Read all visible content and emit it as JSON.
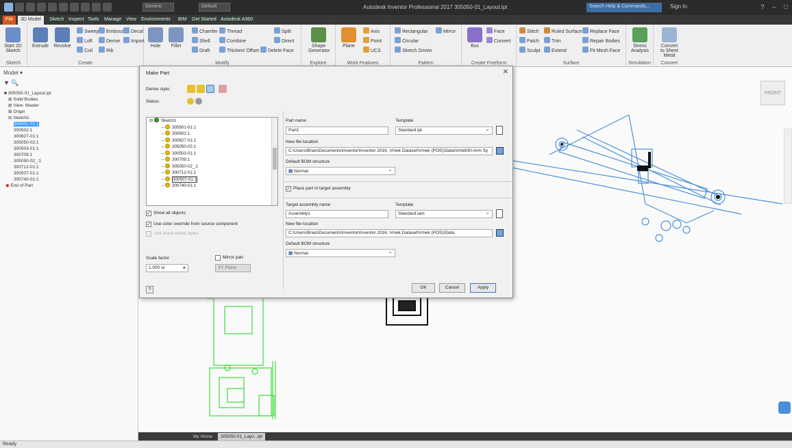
{
  "title_bar": {
    "app_title": "Autodesk Inventor Professional 2017  305050-01_Layout.ipt",
    "combo1": "Generic",
    "combo2": "Default",
    "search_placeholder": "Search Help & Commands...",
    "sign_in": "Sign In"
  },
  "ribbon_tabs": [
    "File",
    "3D Model",
    "Sketch",
    "Inspect",
    "Tools",
    "Manage",
    "View",
    "Environments",
    "BIM",
    "Get Started",
    "Autodesk A360"
  ],
  "ribbon": {
    "sketch_group": {
      "label": "Sketch",
      "start_2d_sketch": "Start 2D Sketch"
    },
    "create_group": {
      "label": "Create",
      "buttons": [
        "Extrude",
        "Revolve",
        "Sweep",
        "Loft",
        "Coil",
        "Emboss",
        "Derive",
        "Rib",
        "Decal",
        "Import"
      ]
    },
    "modify_group": {
      "label": "Modify",
      "buttons": [
        "Hole",
        "Fillet",
        "Chamfer",
        "Shell",
        "Draft",
        "Thread",
        "Combine",
        "Thicken/ Offset",
        "Split",
        "Direct",
        "Delete Face"
      ]
    },
    "explore_group": {
      "label": "Explore",
      "buttons": [
        "Shape Generator"
      ]
    },
    "work_group": {
      "label": "Work Features",
      "buttons": [
        "Plane",
        "Axis",
        "Point",
        "UCS"
      ]
    },
    "pattern_group": {
      "label": "Pattern",
      "buttons": [
        "Rectangular",
        "Circular",
        "Sketch Driven",
        "Mirror"
      ]
    },
    "freeform_group": {
      "label": "Create Freeform",
      "buttons": [
        "Box",
        "Face",
        "Convert"
      ]
    },
    "surface_group": {
      "label": "Surface",
      "buttons": [
        "Stitch",
        "Patch",
        "Sculpt",
        "Trim",
        "Extend",
        "Ruled Surface",
        "Repair Bodies",
        "Fit Mesh Face",
        "Replace Face"
      ]
    },
    "simulation_group": {
      "label": "Simulation",
      "buttons": [
        "Stress Analysis"
      ]
    },
    "convert_group": {
      "label": "Convert",
      "buttons": [
        "Convert to Sheet Metal"
      ]
    }
  },
  "browser": {
    "title": "Model",
    "items": [
      "305050-01_Layout.ipt",
      "Solid Bodies",
      "View: Master",
      "Origin",
      "Sketch1",
      "305501-01:1",
      "300502:1",
      "300627-01:1",
      "305050-02:1",
      "300503-01:1",
      "300709:1",
      "305050-02_:1",
      "300712-01:1",
      "300507-01:1",
      "300740-01:1",
      "End of Part"
    ]
  },
  "make_part_dialog": {
    "title": "Make Part",
    "derive_style_label": "Derive style:",
    "status_label": "Status:",
    "tree_root": "Sketch1",
    "tree_items": [
      "305501-01:1",
      "300502:1",
      "300627-01:1",
      "305050-02:1",
      "300503-01:1",
      "300709:1",
      "305050-02_:1",
      "300712-01:1",
      "300507-01:1",
      "300740-01:1"
    ],
    "show_all_objects": "Show all objects",
    "use_color_override": "Use color override from source component",
    "link_sheet_metal": "Link sheet metal styles",
    "scale_factor_label": "Scale factor",
    "scale_factor_value": "1.000 ul",
    "mirror_part_label": "Mirror part",
    "mirror_plane_value": "XY Plane",
    "part_name_label": "Part name",
    "part_name_value": "Part1",
    "template_label": "Template",
    "part_template_value": "Standard.ipt",
    "new_file_location_label": "New file location",
    "part_location_value": "C:\\Users\\Brian\\Documents\\Inventor\\Inventor 2016, Vmek Dataset\\Vmek (POS)\\Data\\Vmk630-Arm Sy",
    "default_bom_label": "Default BOM structure",
    "part_bom_value": "Normal",
    "place_in_assembly": "Place part in target assembly",
    "target_assembly_label": "Target assembly name",
    "target_assembly_value": "Assembly1",
    "assembly_template_value": "Standard.iam",
    "assembly_location_value": "C:\\Users\\Brian\\Documents\\Inventor\\Inventor 2016, Vmek Dataset\\Vmek (POS)\\Data",
    "assembly_bom_value": "Normal",
    "ok": "OK",
    "cancel": "Cancel",
    "apply": "Apply"
  },
  "viewcube_label": "FRONT",
  "doc_tabs": [
    "My Home",
    "305050-01_Layo...ipt"
  ],
  "status": "Ready",
  "colors": {
    "accent": "#3399ff",
    "file_tab": "#d25a1e",
    "sketch_green": "#3ddc3d",
    "sketch_blue": "#4a90d9"
  }
}
